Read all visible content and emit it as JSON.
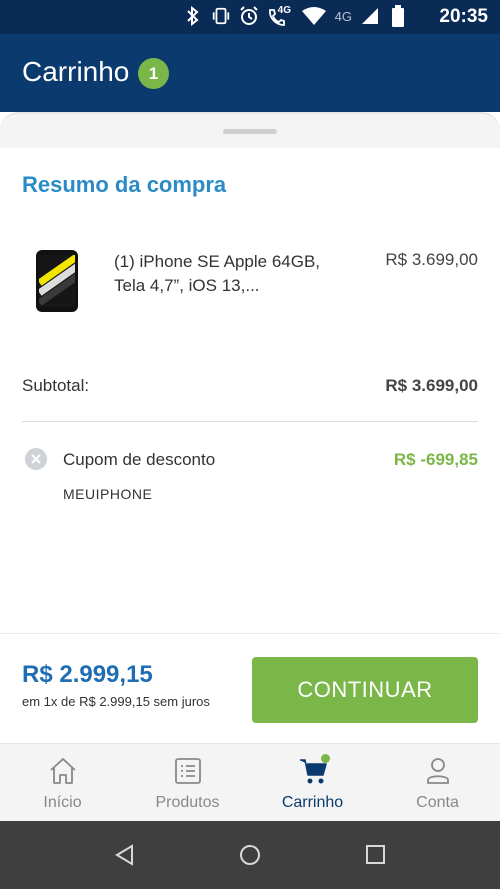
{
  "status_bar": {
    "time": "20:35",
    "network_small": "4G",
    "network": "4G",
    "icons": [
      "bluetooth-icon",
      "vibrate-icon",
      "alarm-icon",
      "call-4g-icon",
      "wifi-icon",
      "signal-icon",
      "battery-icon"
    ]
  },
  "header": {
    "title": "Carrinho",
    "badge_count": "1"
  },
  "summary": {
    "title": "Resumo da compra",
    "product": {
      "name": "(1) iPhone SE Apple 64GB, Tela 4,7”, iOS 13,...",
      "price": "R$ 3.699,00"
    },
    "subtotal_label": "Subtotal:",
    "subtotal_value": "R$ 3.699,00",
    "coupon_label": "Cupom de desconto",
    "coupon_value": "R$ -699,85",
    "coupon_code": "MEUIPHONE"
  },
  "footer": {
    "total": "R$ 2.999,15",
    "installments": "em 1x de R$ 2.999,15 sem juros",
    "continue_label": "CONTINUAR"
  },
  "tabs": [
    {
      "label": "Início",
      "icon": "home-icon"
    },
    {
      "label": "Produtos",
      "icon": "list-icon"
    },
    {
      "label": "Carrinho",
      "icon": "cart-icon"
    },
    {
      "label": "Conta",
      "icon": "user-icon"
    }
  ],
  "colors": {
    "header_bg": "#0b3a6f",
    "accent_green": "#7ab648",
    "title_blue": "#2b8bc6",
    "total_blue": "#1f6db3"
  }
}
